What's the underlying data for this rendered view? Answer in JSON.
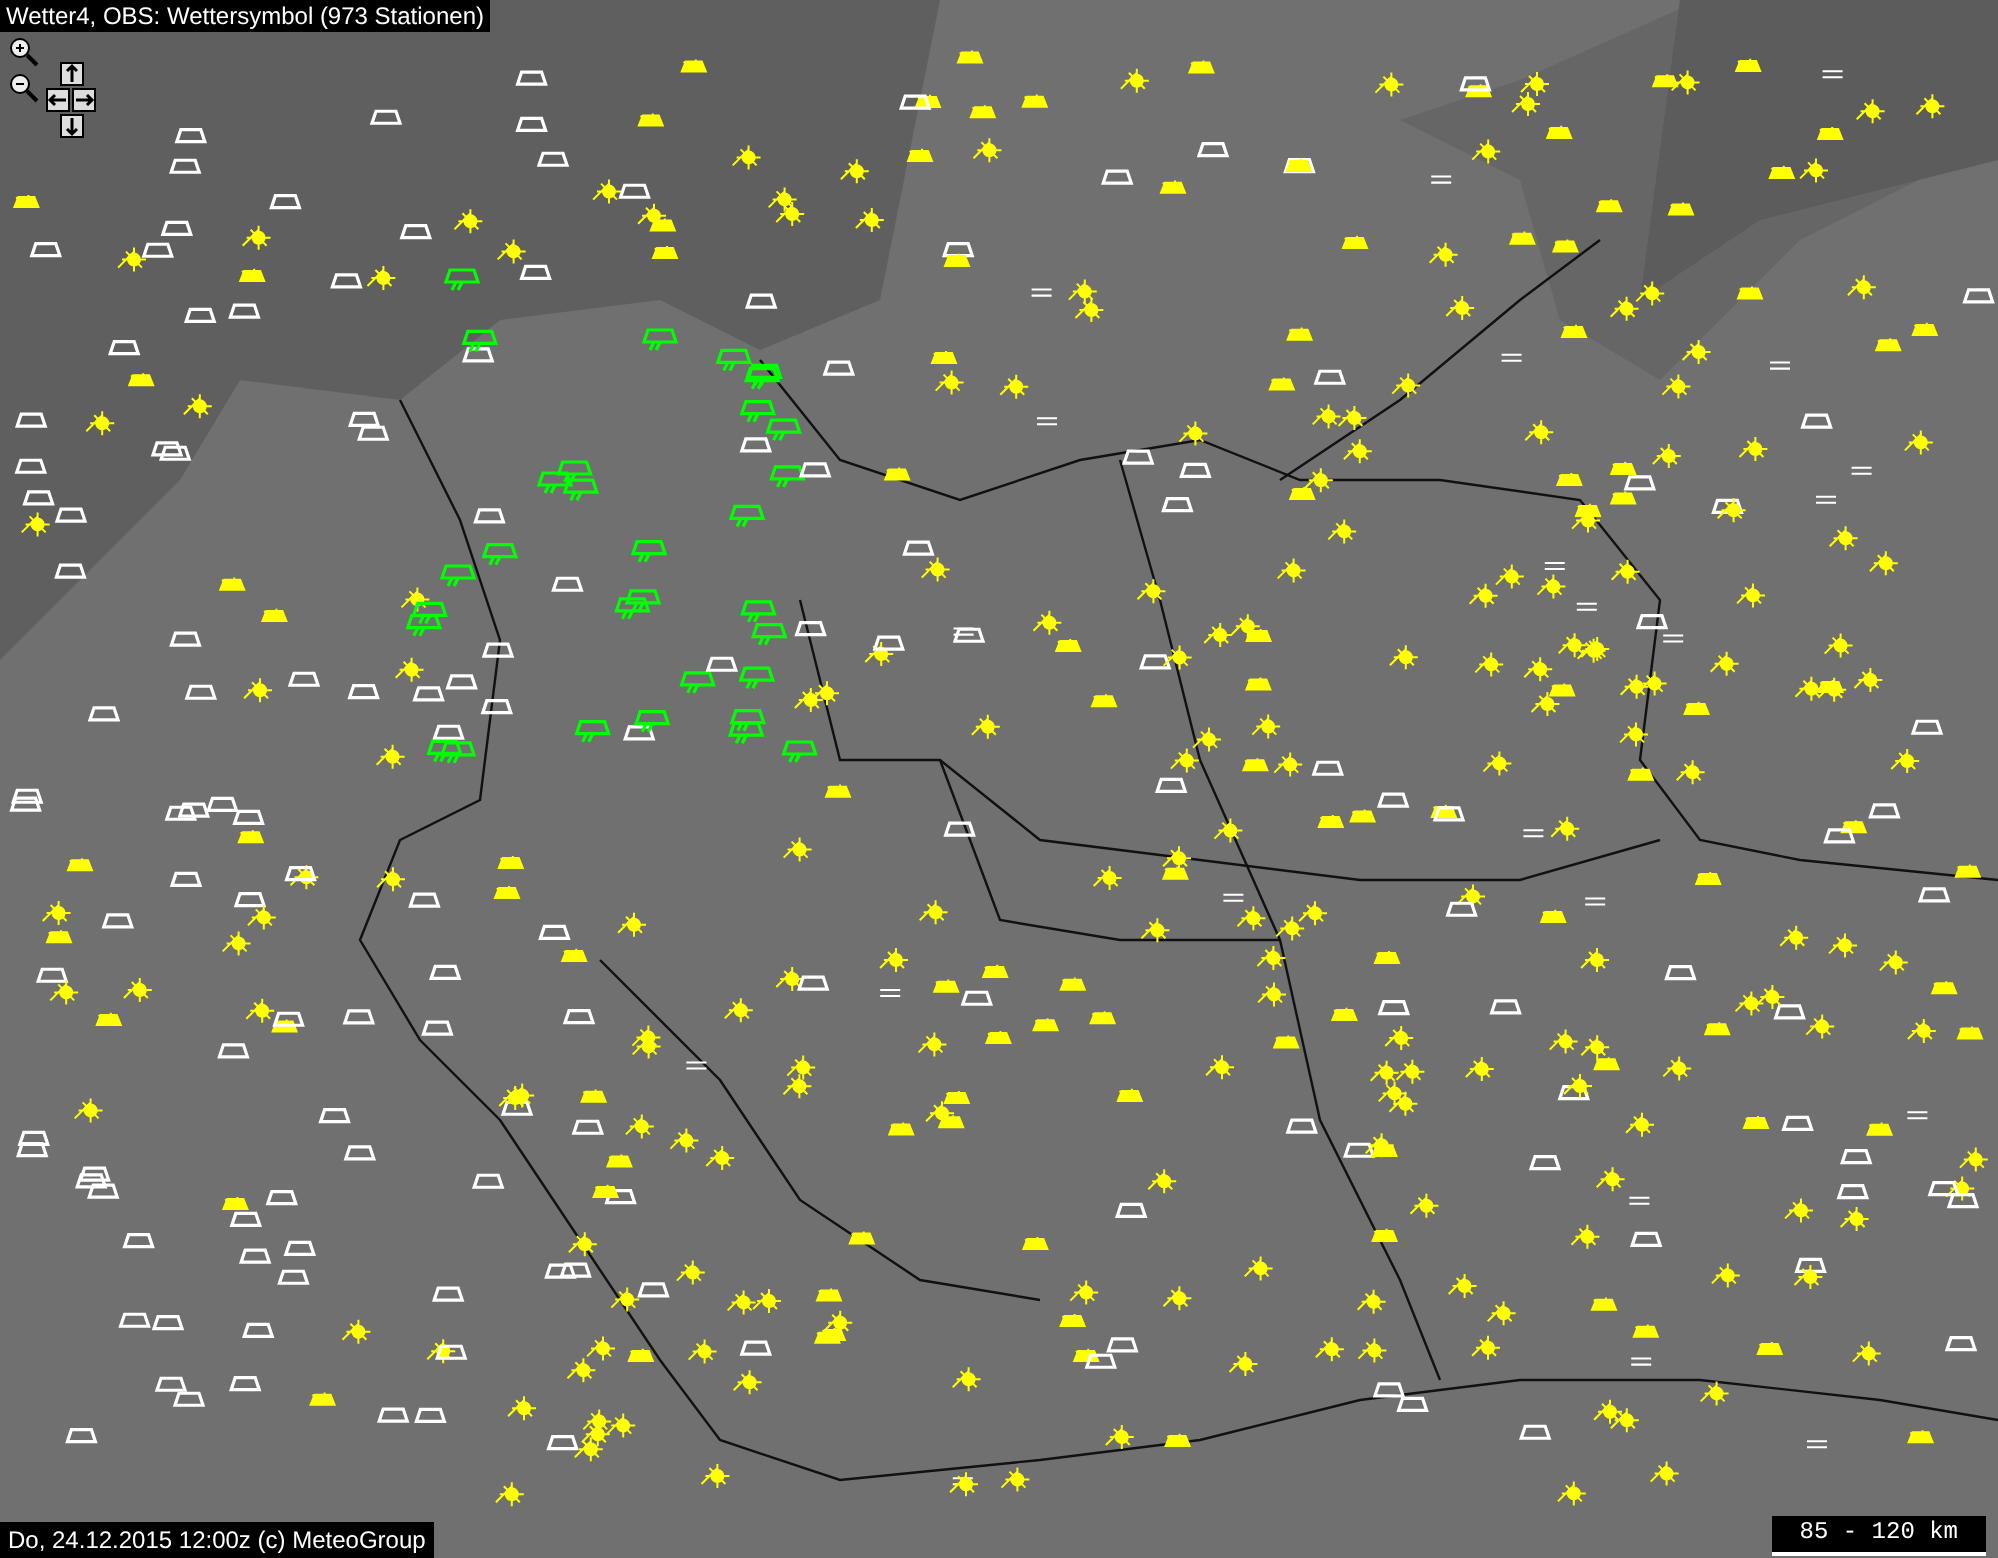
{
  "title": "Wetter4, OBS: Wettersymbol (973 Stationen)",
  "footer": "Do, 24.12.2015 12:00z (c) MeteoGroup",
  "scale": {
    "label": "85 - 120 km"
  }
}
